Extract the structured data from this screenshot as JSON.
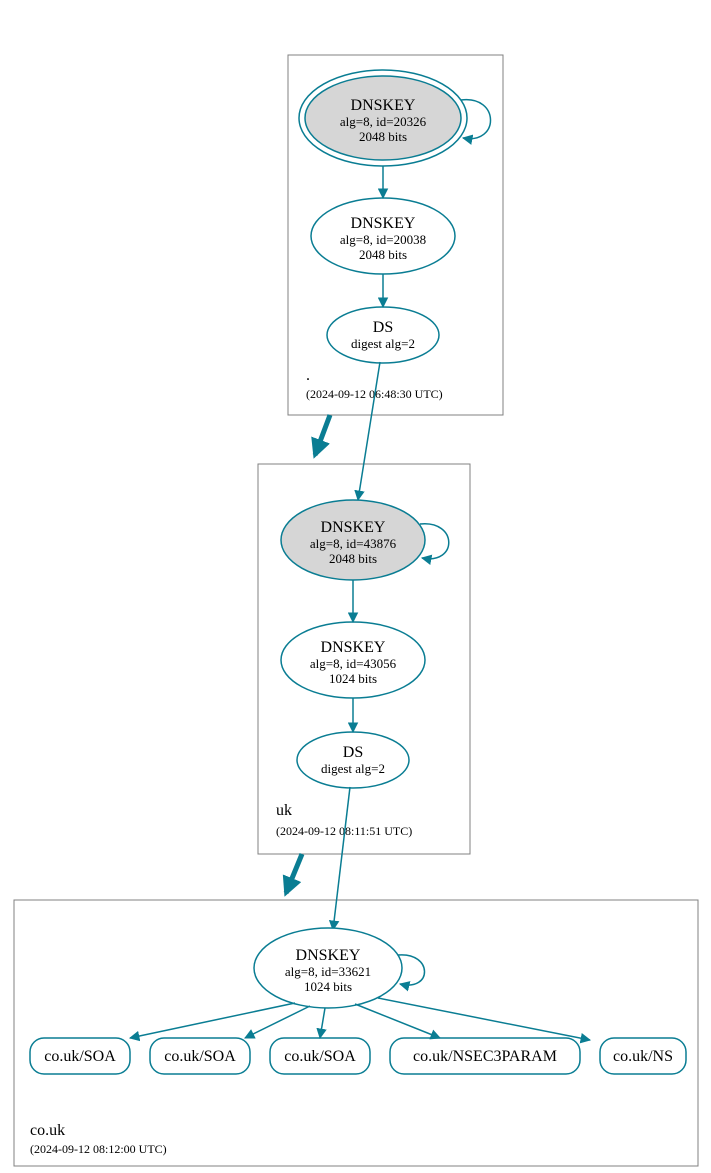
{
  "colors": {
    "stroke": "#0a7d93",
    "fill_grey": "#d6d6d6"
  },
  "zones": {
    "root": {
      "label": ".",
      "timestamp": "(2024-09-12 06:48:30 UTC)"
    },
    "uk": {
      "label": "uk",
      "timestamp": "(2024-09-12 08:11:51 UTC)"
    },
    "couk": {
      "label": "co.uk",
      "timestamp": "(2024-09-12 08:12:00 UTC)"
    }
  },
  "nodes": {
    "root_ksk": {
      "l1": "DNSKEY",
      "l2": "alg=8, id=20326",
      "l3": "2048 bits"
    },
    "root_zsk": {
      "l1": "DNSKEY",
      "l2": "alg=8, id=20038",
      "l3": "2048 bits"
    },
    "root_ds": {
      "l1": "DS",
      "l2": "digest alg=2"
    },
    "uk_ksk": {
      "l1": "DNSKEY",
      "l2": "alg=8, id=43876",
      "l3": "2048 bits"
    },
    "uk_zsk": {
      "l1": "DNSKEY",
      "l2": "alg=8, id=43056",
      "l3": "1024 bits"
    },
    "uk_ds": {
      "l1": "DS",
      "l2": "digest alg=2"
    },
    "couk_key": {
      "l1": "DNSKEY",
      "l2": "alg=8, id=33621",
      "l3": "1024 bits"
    }
  },
  "leaves": {
    "soa1": "co.uk/SOA",
    "soa2": "co.uk/SOA",
    "soa3": "co.uk/SOA",
    "nsec": "co.uk/NSEC3PARAM",
    "ns": "co.uk/NS"
  }
}
